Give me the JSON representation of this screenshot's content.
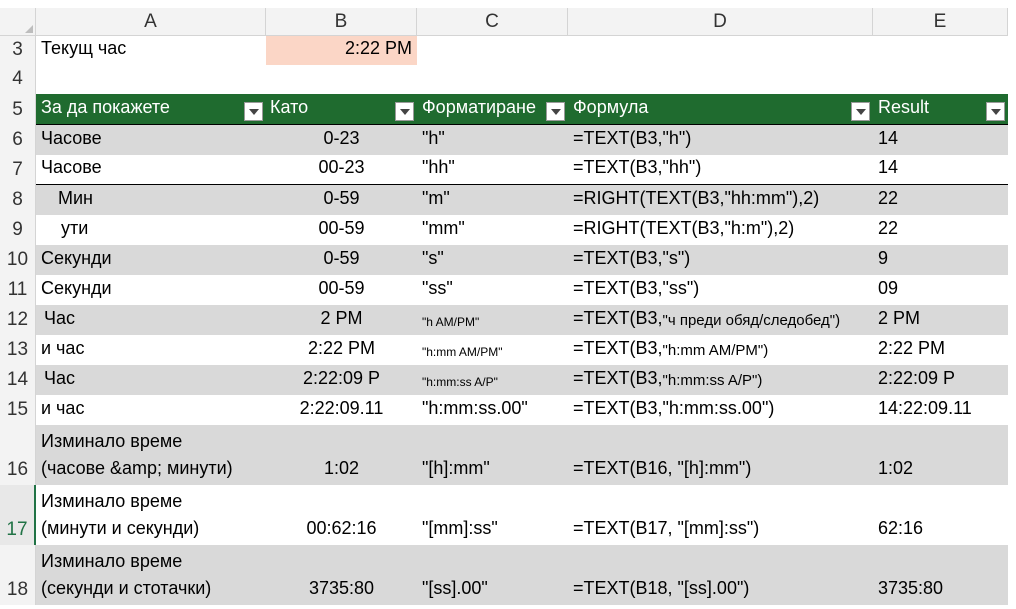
{
  "columns": [
    "A",
    "B",
    "C",
    "D",
    "E"
  ],
  "row3": {
    "num": "3",
    "label": "Текущ час",
    "value": "2:22 PM"
  },
  "row4": {
    "num": "4"
  },
  "header": {
    "num": "5",
    "a": "За да покажете",
    "b": "Като",
    "c": "Форматиране",
    "d": "Формула",
    "e": "Result"
  },
  "rows": [
    {
      "num": "6",
      "a": "Часове",
      "b": "0-23",
      "c": "\"h\"",
      "d": "=TEXT(B3,\"h\")",
      "e": "14"
    },
    {
      "num": "7",
      "a": "Часове",
      "b": "00-23",
      "c": "\"hh\"",
      "d": "=TEXT(B3,\"hh\")",
      "e": "14"
    },
    {
      "num": "8",
      "a": "    Мин",
      "b": "0-59",
      "c": "\"m\"",
      "d": "=RIGHT(TEXT(B3,\"hh:mm\"),2)",
      "e": "22"
    },
    {
      "num": "9",
      "a": "    ути",
      "b": "00-59",
      "c": "\"mm\"",
      "d": "=RIGHT(TEXT(B3,\"h:m\"),2)",
      "e": "22"
    },
    {
      "num": "10",
      "a": "Секунди",
      "b": "0-59",
      "c": "\"s\"",
      "d": "=TEXT(B3,\"s\")",
      "e": "9"
    },
    {
      "num": "11",
      "a": "Секунди",
      "b": "00-59",
      "c": "\"ss\"",
      "d": "=TEXT(B3,\"ss\")",
      "e": "09"
    },
    {
      "num": "12",
      "a": " Час",
      "b": "2 PM",
      "c": "\"h AM/PM\"",
      "d1": "=TEXT(B3,",
      "d2": "\"ч преди обяд/следобед\")",
      "e": "2 PM"
    },
    {
      "num": "13",
      "a": "и час",
      "b": "2:22 PM",
      "c": "\"h:mm AM/PM\"",
      "d1": "=TEXT(B3,",
      "d2": "\"h:mm AM/PM\")",
      "e": "2:22 PM"
    },
    {
      "num": "14",
      "a": " Час",
      "b": "2:22:09 P",
      "c": "\"h:mm:ss A/P\"",
      "d1": "=TEXT(B3,",
      "d2": "\"h:mm:ss A/P\")",
      "e": "2:22:09 P"
    },
    {
      "num": "15",
      "a": "и час",
      "b": "2:22:09.11",
      "c": "\"h:mm:ss.00\"",
      "d": "=TEXT(B3,\"h:mm:ss.00\")",
      "e": "14:22:09.11"
    }
  ],
  "tall_rows": [
    {
      "num": "16",
      "a1": "Изминало време",
      "a2": "(часове &amp; минути)",
      "b": "1:02",
      "c": "\"[h]:mm\"",
      "d": "=TEXT(B16, \"[h]:mm\")",
      "e": "1:02"
    },
    {
      "num": "17",
      "a1": "Изминало време",
      "a2": "(минути и секунди)",
      "b": "00:62:16",
      "c": "\"[mm]:ss\"",
      "d": "=TEXT(B17, \"[mm]:ss\")",
      "e": "62:16"
    },
    {
      "num": "18",
      "a1": "Изминало време",
      "a2": "(секунди и стотачки)",
      "b": "3735:80",
      "c": "\"[ss].00\"",
      "d": "=TEXT(B18, \"[ss].00\")",
      "e": "3735:80"
    }
  ]
}
